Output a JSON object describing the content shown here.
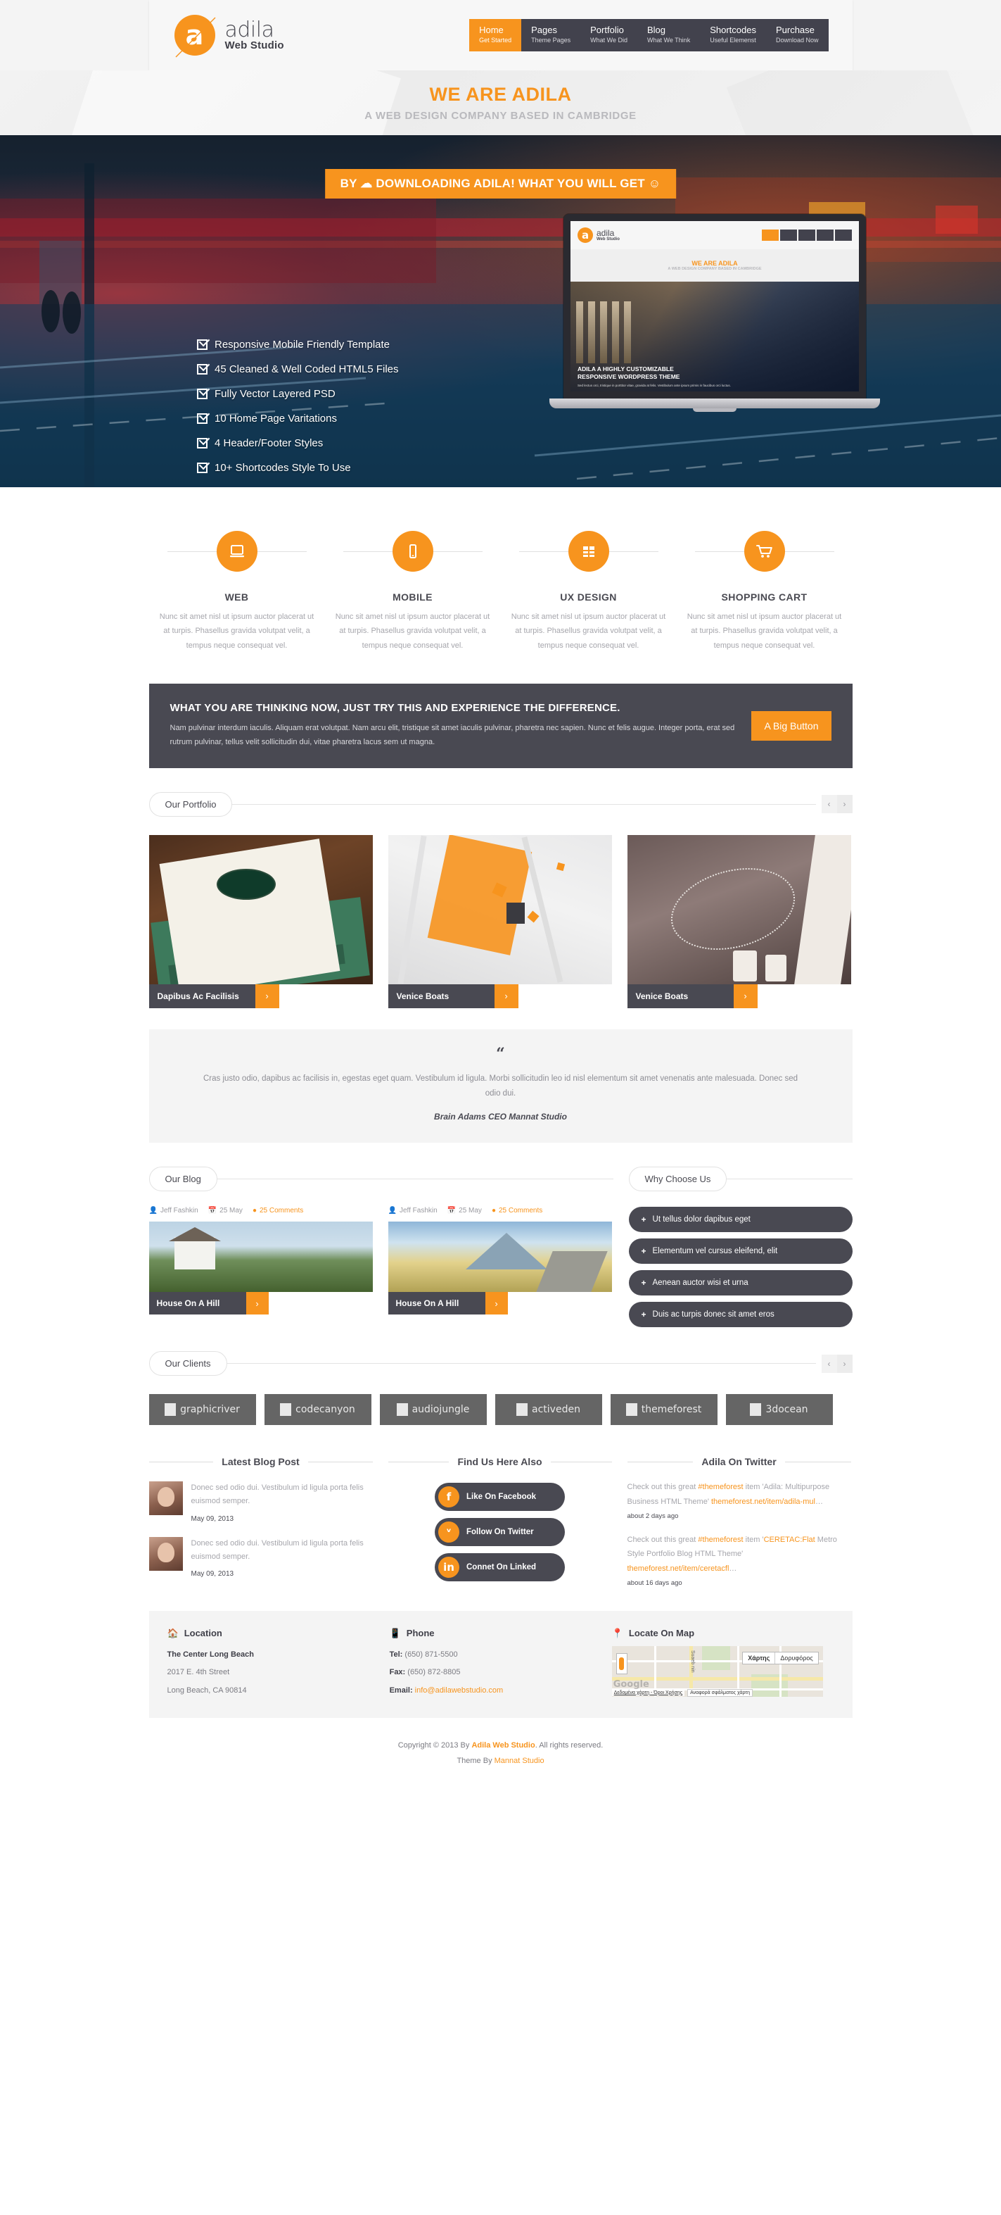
{
  "header": {
    "brand": {
      "letter": "a",
      "name": "adila",
      "sub": "Web Studio"
    },
    "nav": [
      {
        "title": "Home",
        "sub": "Get Started",
        "active": true
      },
      {
        "title": "Pages",
        "sub": "Theme Pages",
        "active": false
      },
      {
        "title": "Portfolio",
        "sub": "What We Did",
        "active": false
      },
      {
        "title": "Blog",
        "sub": "What We Think",
        "active": false
      },
      {
        "title": "Shortcodes",
        "sub": "Useful Elemenst",
        "active": false
      },
      {
        "title": "Purchase",
        "sub": "Download Now",
        "active": false
      }
    ]
  },
  "band": {
    "title": "WE ARE ADILA",
    "subtitle": "A WEB DESIGN COMPANY BASED IN CAMBRIDGE"
  },
  "hero": {
    "badge": "BY ☁ DOWNLOADING ADILA! WHAT YOU WILL GET ☺",
    "features": [
      "Responsive Mobile Friendly Template",
      "45 Cleaned & Well Coded HTML5 Files",
      "Fully Vector Layered PSD",
      "10 Home Page Varitations",
      "4 Header/Footer Styles",
      "10+ Shortcodes Style To Use"
    ],
    "laptop": {
      "logo_letter": "a",
      "logo_name": "adila",
      "logo_sub": "Web Studio",
      "band_title": "WE ARE ADILA",
      "band_sub": "A WEB DESIGN COMPANY BASED IN CAMBRIDGE",
      "caption_line1": "ADILA  A HIGHLY CUSTOMIZABLE",
      "caption_line2": "RESPONSIVE WORDPRESS THEME",
      "caption_body": "Sed lectus orci, tristique in porttitor vitae, gravida at felis. Vestibulum ante ipsum primis in faucibus orci luctus."
    }
  },
  "services": [
    {
      "icon": "laptop-icon",
      "name": "WEB",
      "desc": "Nunc sit amet nisl ut ipsum auctor placerat ut at turpis. Phasellus gravida volutpat velit, a tempus neque consequat vel."
    },
    {
      "icon": "mobile-icon",
      "name": "MOBILE",
      "desc": "Nunc sit amet nisl ut ipsum auctor placerat ut at turpis. Phasellus gravida volutpat velit, a tempus neque consequat vel."
    },
    {
      "icon": "grid-icon",
      "name": "UX DESIGN",
      "desc": "Nunc sit amet nisl ut ipsum auctor placerat ut at turpis. Phasellus gravida volutpat velit, a tempus neque consequat vel."
    },
    {
      "icon": "cart-icon",
      "name": "SHOPPING CART",
      "desc": "Nunc sit amet nisl ut ipsum auctor placerat ut at turpis. Phasellus gravida volutpat velit, a tempus neque consequat vel."
    }
  ],
  "callout": {
    "heading": "WHAT YOU ARE THINKING NOW, JUST TRY THIS AND EXPERIENCE THE DIFFERENCE.",
    "body": "Nam pulvinar interdum iaculis. Aliquam erat volutpat. Nam arcu elit, tristique sit amet iaculis pulvinar, pharetra nec sapien. Nunc et felis augue. Integer porta, erat sed rutrum pulvinar, tellus velit sollicitudin dui, vitae pharetra lacus sem ut magna.",
    "button": "A Big Button"
  },
  "portfolio": {
    "heading": "Our Portfolio",
    "prev": "‹",
    "next": "›",
    "items": [
      {
        "title": "Dapibus Ac Facilisis",
        "arrow": "›"
      },
      {
        "title": "Venice Boats",
        "arrow": "›"
      },
      {
        "title": "Venice Boats",
        "arrow": "›"
      }
    ]
  },
  "testimonial": {
    "quote_mark": "“",
    "text": "Cras justo odio, dapibus ac facilisis in, egestas eget quam. Vestibulum id ligula. Morbi sollicitudin leo id nisl elementum sit amet venenatis ante malesuada. Donec sed odio dui.",
    "author": "Brain Adams CEO Mannat Studio"
  },
  "blog": {
    "heading": "Our Blog",
    "posts": [
      {
        "author": "Jeff Fashkin",
        "date": "25 May",
        "comments": "25 Comments",
        "title": "House On A Hill",
        "arrow": "›"
      },
      {
        "author": "Jeff Fashkin",
        "date": "25 May",
        "comments": "25 Comments",
        "title": "House On A Hill",
        "arrow": "›"
      }
    ]
  },
  "why_choose": {
    "heading": "Why Choose Us",
    "items": [
      "Ut tellus dolor dapibus eget",
      "Elementum vel cursus eleifend, elit",
      "Aenean auctor wisi et urna",
      "Duis ac turpis donec sit amet eros"
    ]
  },
  "clients": {
    "heading": "Our Clients",
    "prev": "‹",
    "next": "›",
    "logos": [
      "graphicriver",
      "codecanyon",
      "audiojungle",
      "activeden",
      "themeforest",
      "3docean"
    ]
  },
  "footer_widgets": {
    "latest_blog": {
      "title": "Latest Blog Post",
      "posts": [
        {
          "text": "Donec sed odio dui. Vestibulum id ligula porta felis euismod semper.",
          "date": "May 09, 2013"
        },
        {
          "text": "Donec sed odio dui. Vestibulum id ligula porta felis euismod semper.",
          "date": "May 09, 2013"
        }
      ]
    },
    "find_us": {
      "title": "Find Us Here Also",
      "buttons": [
        {
          "icon": "facebook-icon",
          "glyph": "f",
          "label": "Like On Facebook"
        },
        {
          "icon": "twitter-icon",
          "glyph": "ᵛ",
          "label": "Follow On Twitter"
        },
        {
          "icon": "linkedin-icon",
          "glyph": "in",
          "label": "Connet On Linked"
        }
      ]
    },
    "twitter": {
      "title": "Adila On Twitter",
      "tweets": [
        {
          "p1": "Check out this great ",
          "hl1": "#themeforest",
          "p2": " item 'Adila: Multipurpose Business HTML Theme' ",
          "hl2": "themeforest.net/item/adila-mul",
          "p3": "…",
          "time": "about 2 days ago"
        },
        {
          "p1": "Check out this great ",
          "hl1": "#themeforest",
          "p2": " item '",
          "hl2": "CERETAC:Flat",
          "p3": " Metro Style Portfolio Blog HTML Theme' ",
          "hl3": "themeforest.net/item/ceretacfl",
          "p4": "…",
          "time": "about 16 days ago"
        }
      ]
    }
  },
  "contact": {
    "location": {
      "icon": "home-icon",
      "title": "Location",
      "name": "The Center Long Beach",
      "street": "2017 E. 4th Street",
      "city": "Long Beach, CA 90814"
    },
    "phone": {
      "icon": "phone-icon",
      "title": "Phone",
      "tel_label": "Tel:",
      "tel": "(650) 871-5500",
      "fax_label": "Fax:",
      "fax": "(650) 872-8805",
      "email_label": "Email:",
      "email": "info@adilawebstudio.com"
    },
    "map": {
      "icon": "pin-icon",
      "title": "Locate On Map",
      "btn_map": "Χάρτης",
      "btn_sat": "Δορυφόρος",
      "attr_left": "Δεδομένα χάρτη - Όροι Χρήσης",
      "attr_right": "Αναφορά σφάλματος χάρτη",
      "watermark": "Google",
      "street_label": "Suaeb nin"
    }
  },
  "copyright": {
    "line1_pre": "Copyright © 2013 By ",
    "line1_brand": "Adila Web Studio",
    "line1_post": ". All rights reserved.",
    "line2_pre": "Theme By ",
    "line2_brand": "Mannat Studio"
  },
  "colors": {
    "accent": "#f7941e",
    "dark": "#494952",
    "muted": "#a6a6ac"
  }
}
